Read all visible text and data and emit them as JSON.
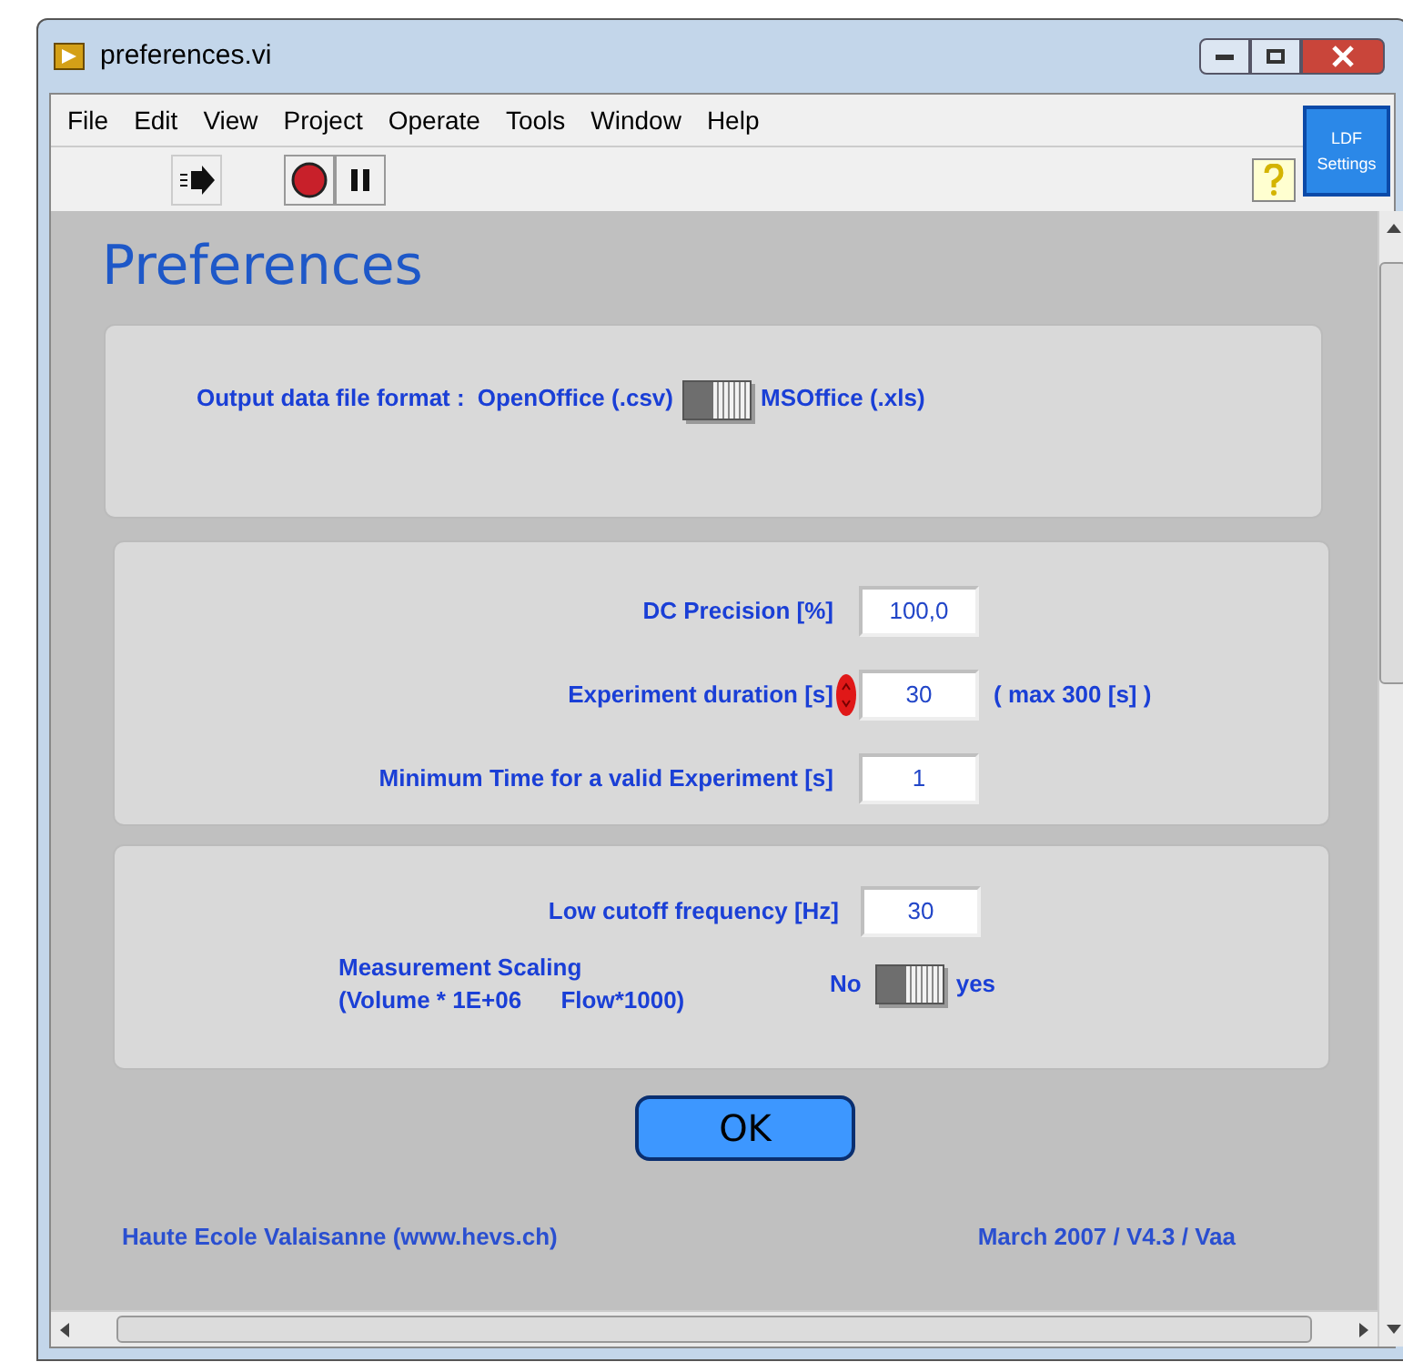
{
  "window": {
    "title": "preferences.vi"
  },
  "menu": [
    "File",
    "Edit",
    "View",
    "Project",
    "Operate",
    "Tools",
    "Window",
    "Help"
  ],
  "toolbar": {
    "side_button": "LDF Settings"
  },
  "heading": "Preferences",
  "format_panel": {
    "label": "Output data file format :",
    "left_option": "OpenOffice (.csv)",
    "right_option": "MSOffice (.xls)",
    "on": true
  },
  "acquisition_fields": [
    {
      "label": "DC Precision [%]",
      "value": "100,0",
      "spinner": false
    },
    {
      "label": "Experiment duration [s]",
      "value": "30",
      "spinner": true,
      "note": "( max 300 [s] )"
    },
    {
      "label": "Minimum Time for a valid Experiment [s]",
      "value": "1",
      "spinner": false
    }
  ],
  "filter_panel": {
    "field": {
      "label": "Low cutoff frequency [Hz]",
      "value": "30"
    },
    "scaling": {
      "label_lines": [
        "Measurement Scaling",
        "(Volume * 1E+06      Flow*1000)"
      ],
      "off_label": "No",
      "on_label": "yes",
      "on": true
    }
  },
  "ok_button": "OK",
  "footer": {
    "left": "Haute Ecole Valaisanne (www.hevs.ch)",
    "right": "March 2007 / V4.3 / Vaa"
  }
}
